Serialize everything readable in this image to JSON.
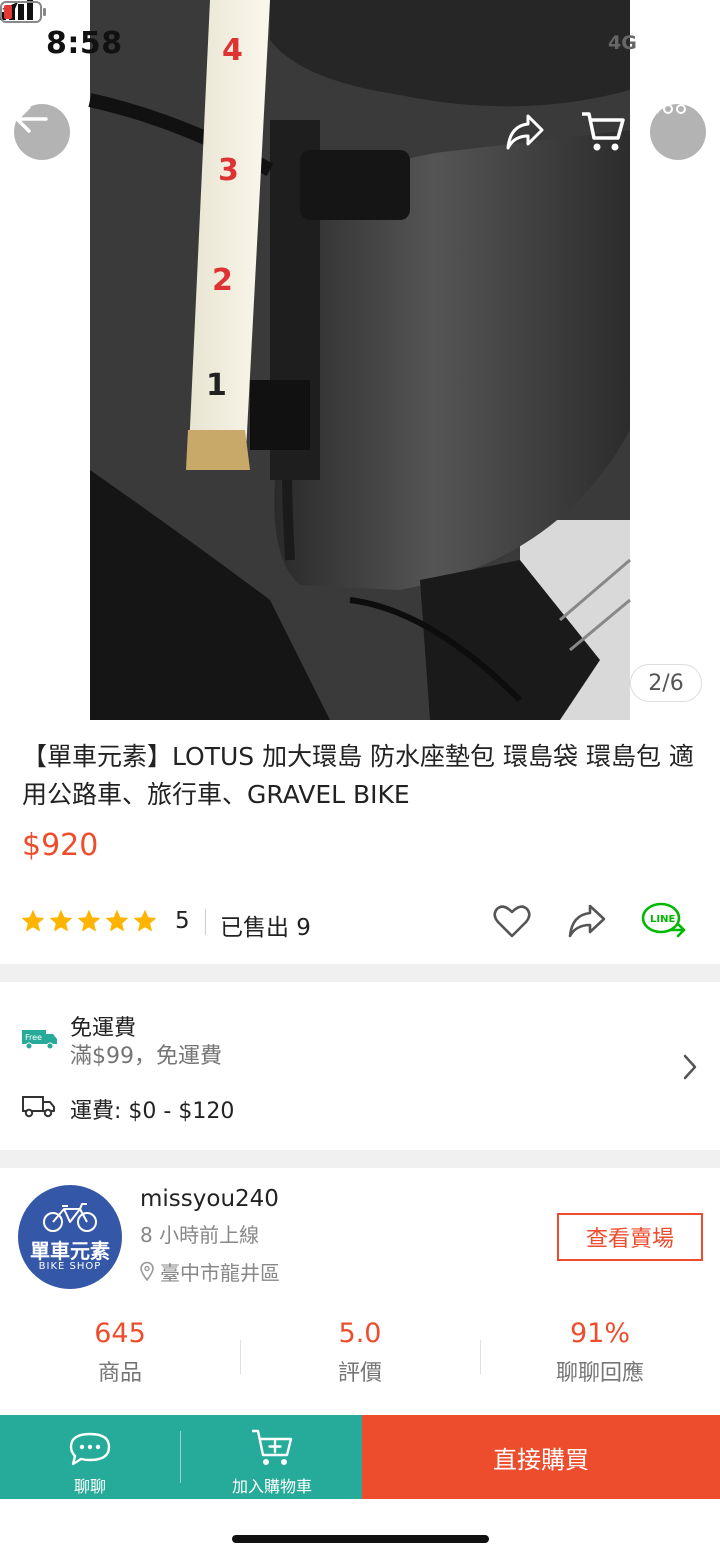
{
  "status_bar": {
    "time": "8:58",
    "network": "4G",
    "icons": [
      "location-arrow-icon",
      "signal-icon",
      "battery-low-icon"
    ]
  },
  "header": {
    "icons": [
      "back-arrow-icon",
      "share-icon",
      "cart-icon",
      "more-icon"
    ]
  },
  "gallery": {
    "counter": "2/6"
  },
  "product": {
    "title": "【單車元素】LOTUS 加大環島 防水座墊包 環島袋 環島包 適用公路車、旅行車、GRAVEL BIKE",
    "price": "$920",
    "rating": {
      "score": 5,
      "label": "5",
      "stars": 5
    },
    "sold": "已售出 9",
    "actions": [
      "heart-icon",
      "share-icon",
      "line-share-icon"
    ]
  },
  "shipping": {
    "free_title": "免運費",
    "free_subtitle": "滿$99，免運費",
    "fee": "運費: $0 - $120",
    "free_badge": "Free"
  },
  "shop": {
    "name": "missyou240",
    "online": "8 小時前上線",
    "location": "臺中市龍井區",
    "view_button": "查看賣場",
    "avatar_text_cn": "單車元素",
    "avatar_text_en": "BIKE SHOP",
    "stats": [
      {
        "value": "645",
        "label": "商品"
      },
      {
        "value": "5.0",
        "label": "評價"
      },
      {
        "value": "91%",
        "label": "聊聊回應"
      }
    ]
  },
  "bottom_bar": {
    "chat_label": "聊聊",
    "add_to_cart_label": "加入購物車",
    "buy_now_label": "直接購買"
  },
  "colors": {
    "brand": "#ee4d2d",
    "teal": "#26aa99",
    "star": "#ffb400"
  }
}
